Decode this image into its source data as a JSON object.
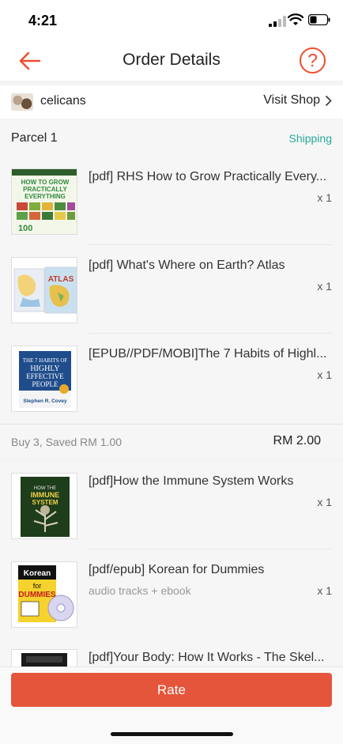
{
  "status_bar": {
    "time": "4:21"
  },
  "header": {
    "title": "Order Details",
    "help_icon": "question-mark",
    "back_icon": "arrow-left"
  },
  "colors": {
    "accent": "#ee4d2d",
    "shipping_status": "#26aa99",
    "rate_button": "#e5553b"
  },
  "shop": {
    "name": "celicans",
    "visit_label": "Visit Shop"
  },
  "parcel": {
    "label": "Parcel 1",
    "status": "Shipping"
  },
  "items": [
    {
      "title": "[pdf] RHS How to Grow Practically Every...",
      "variation": "",
      "qty": "x 1",
      "cover_text": "HOW TO GROW PRACTICALLY EVERYTHING"
    },
    {
      "title": "[pdf] What's Where on Earth? Atlas",
      "variation": "",
      "qty": "x 1",
      "cover_text": "ATLAS"
    },
    {
      "title": "[EPUB//PDF/MOBI]The 7 Habits of Highl...",
      "variation": "",
      "qty": "x 1",
      "cover_text": "THE 7 HABITS OF HIGHLY EFFECTIVE PEOPLE"
    },
    {
      "title": "[pdf]How the Immune System Works",
      "variation": "",
      "qty": "x 1",
      "cover_text": "IMMUNE SYSTEM"
    },
    {
      "title": "[pdf/epub] Korean for Dummies",
      "variation": "audio tracks + ebook",
      "qty": "x 1",
      "cover_text": "Korean DUMMIES"
    },
    {
      "title": "[pdf]Your Body: How It Works - The Skel...",
      "variation": "",
      "qty": "",
      "cover_text": ""
    }
  ],
  "summary": {
    "label": "Buy 3, Saved RM 1.00",
    "price": "RM 2.00"
  },
  "footer": {
    "rate_label": "Rate"
  }
}
